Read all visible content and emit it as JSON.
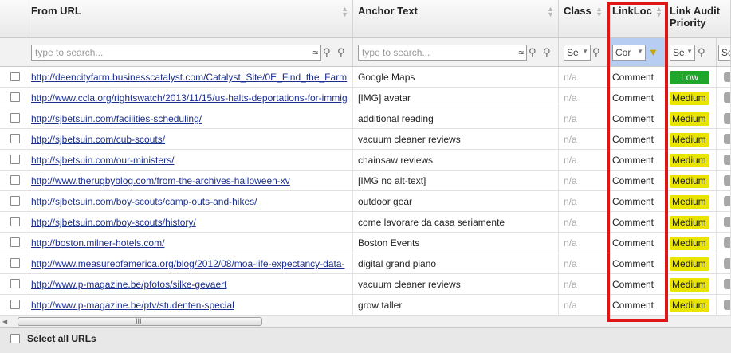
{
  "columns": {
    "from_url": "From URL",
    "anchor_text": "Anchor Text",
    "class": "Class",
    "linkloc": "LinkLoc",
    "priority": "Link Audit Priority"
  },
  "filters": {
    "url_placeholder": "type to search...",
    "anchor_placeholder": "type to search...",
    "approx_symbol": "≈",
    "class_select": "Se",
    "linkloc_select": "Cor",
    "priority_select": "Se",
    "extra_select": "Se"
  },
  "rows": [
    {
      "url": "http://deencityfarm.businesscatalyst.com/Catalyst_Site/0E_Find_the_Farm",
      "anchor": "Google Maps",
      "class": "n/a",
      "linkloc": "Comment",
      "priority": "Low"
    },
    {
      "url": "http://www.ccla.org/rightswatch/2013/11/15/us-halts-deportations-for-immig",
      "anchor": "[IMG] avatar",
      "class": "n/a",
      "linkloc": "Comment",
      "priority": "Medium"
    },
    {
      "url": "http://sjbetsuin.com/facilities-scheduling/",
      "anchor": "additional reading",
      "class": "n/a",
      "linkloc": "Comment",
      "priority": "Medium"
    },
    {
      "url": "http://sjbetsuin.com/cub-scouts/",
      "anchor": "vacuum cleaner reviews",
      "class": "n/a",
      "linkloc": "Comment",
      "priority": "Medium"
    },
    {
      "url": "http://sjbetsuin.com/our-ministers/",
      "anchor": "chainsaw reviews",
      "class": "n/a",
      "linkloc": "Comment",
      "priority": "Medium"
    },
    {
      "url": "http://www.therugbyblog.com/from-the-archives-halloween-xv",
      "anchor": "[IMG no alt-text]",
      "class": "n/a",
      "linkloc": "Comment",
      "priority": "Medium"
    },
    {
      "url": "http://sjbetsuin.com/boy-scouts/camp-outs-and-hikes/",
      "anchor": "outdoor gear",
      "class": "n/a",
      "linkloc": "Comment",
      "priority": "Medium"
    },
    {
      "url": "http://sjbetsuin.com/boy-scouts/history/",
      "anchor": "come lavorare da casa seriamente",
      "class": "n/a",
      "linkloc": "Comment",
      "priority": "Medium"
    },
    {
      "url": "http://boston.milner-hotels.com/",
      "anchor": "Boston Events",
      "class": "n/a",
      "linkloc": "Comment",
      "priority": "Medium"
    },
    {
      "url": "http://www.measureofamerica.org/blog/2012/08/moa-life-expectancy-data-",
      "anchor": "digital grand piano",
      "class": "n/a",
      "linkloc": "Comment",
      "priority": "Medium"
    },
    {
      "url": "http://www.p-magazine.be/pfotos/silke-gevaert",
      "anchor": "vacuum cleaner reviews",
      "class": "n/a",
      "linkloc": "Comment",
      "priority": "Medium"
    },
    {
      "url": "http://www.p-magazine.be/ptv/studenten-special",
      "anchor": "grow taller",
      "class": "n/a",
      "linkloc": "Comment",
      "priority": "Medium"
    }
  ],
  "footer": {
    "select_all": "Select all URLs",
    "scroll_grip": "III"
  },
  "colors": {
    "low": "#22a52b",
    "medium": "#e9e400",
    "highlight": "#e01515",
    "link": "#1b2f8f"
  }
}
